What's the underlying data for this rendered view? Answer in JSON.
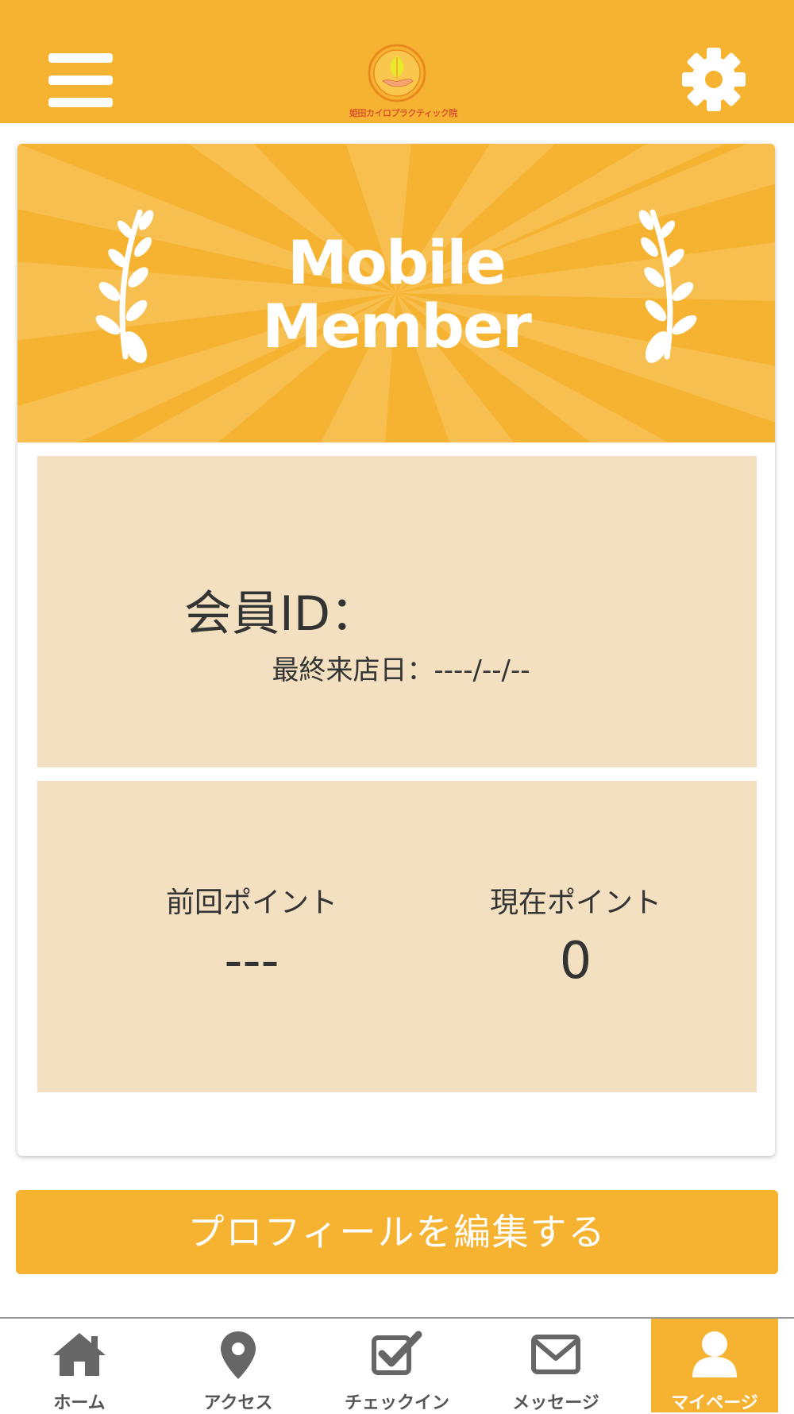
{
  "header": {
    "logo_text": "姫田カイロプラクティック院",
    "menu_icon": "hamburger-menu-icon",
    "settings_icon": "gear-icon"
  },
  "banner": {
    "line1": "Mobile",
    "line2": "Member"
  },
  "member": {
    "id_label": "会員ID：",
    "last_visit_label": "最終来店日：",
    "last_visit_value": "----/--/--"
  },
  "points": {
    "previous_label": "前回ポイント",
    "previous_value": "---",
    "current_label": "現在ポイント",
    "current_value": "0"
  },
  "edit_profile_label": "プロフィールを編集する",
  "tabs": [
    {
      "label": "ホーム",
      "icon": "home-icon"
    },
    {
      "label": "アクセス",
      "icon": "map-pin-icon"
    },
    {
      "label": "チェックイン",
      "icon": "checkbox-icon"
    },
    {
      "label": "メッセージ",
      "icon": "envelope-icon"
    },
    {
      "label": "マイページ",
      "icon": "user-icon",
      "active": true
    }
  ],
  "colors": {
    "accent": "#F6B332",
    "panel": "#F2E0C1",
    "text": "#333333"
  }
}
